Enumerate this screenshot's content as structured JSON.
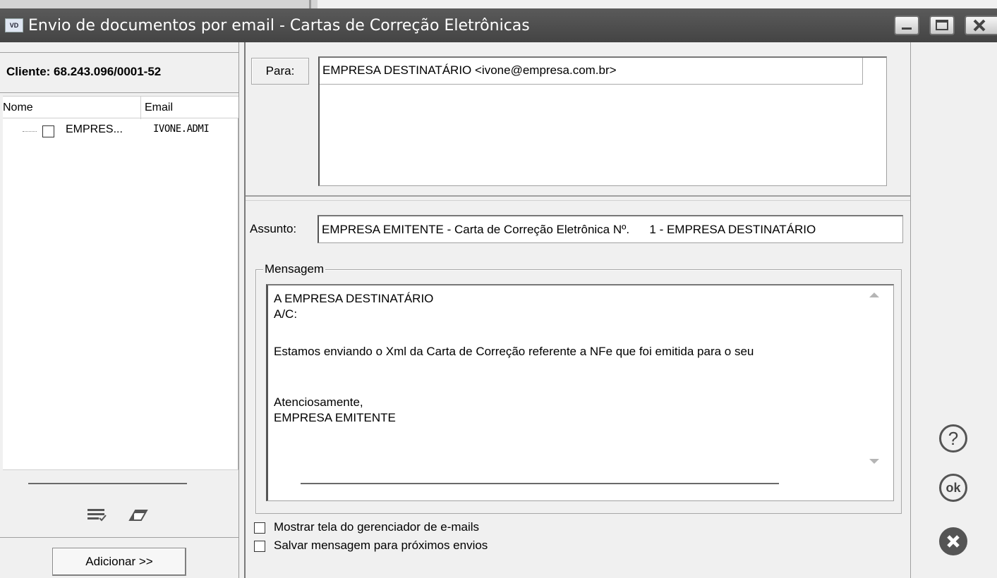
{
  "window": {
    "app_icon_text": "VD",
    "title": "Envio de documentos por email - Cartas de Correção Eletrônicas"
  },
  "window_controls": {
    "minimize_icon": "minimize-icon",
    "maximize_icon": "maximize-icon",
    "close_icon": "close-icon"
  },
  "left_panel": {
    "cliente_label": "Cliente: 68.243.096/0001-52",
    "columns": {
      "nome": "Nome",
      "email": "Email"
    },
    "rows": [
      {
        "nome": "EMPRES...",
        "email": "IVONE.ADMI",
        "checked": false
      }
    ],
    "tools": [
      "check-list-icon",
      "eraser-icon"
    ],
    "add_button": "Adicionar >>"
  },
  "form": {
    "para_label": "Para:",
    "para_value": "EMPRESA DESTINATÁRIO <ivone@empresa.com.br>",
    "assunto_label": "Assunto:",
    "assunto_value": "EMPRESA EMITENTE - Carta de Correção Eletrônica Nº.      1 - EMPRESA DESTINATÁRIO",
    "mensagem_legend": "Mensagem",
    "mensagem_lines": [
      "A EMPRESA DESTINATÁRIO",
      "A/C:",
      "",
      "Estamos enviando o Xml da Carta de Correção referente a NFe que foi emitida para o seu",
      "",
      "",
      "Atenciosamente,",
      "EMPRESA EMITENTE"
    ],
    "options": [
      {
        "label": "Mostrar tela do gerenciador de e-mails",
        "checked": false
      },
      {
        "label": "Salvar mensagem para próximos envios",
        "checked": false
      }
    ]
  },
  "side_buttons": {
    "help": "?",
    "ok": "ok"
  },
  "colors": {
    "titlebar": "#4d4d4d",
    "background": "#f0f0f0",
    "text": "#000000"
  }
}
